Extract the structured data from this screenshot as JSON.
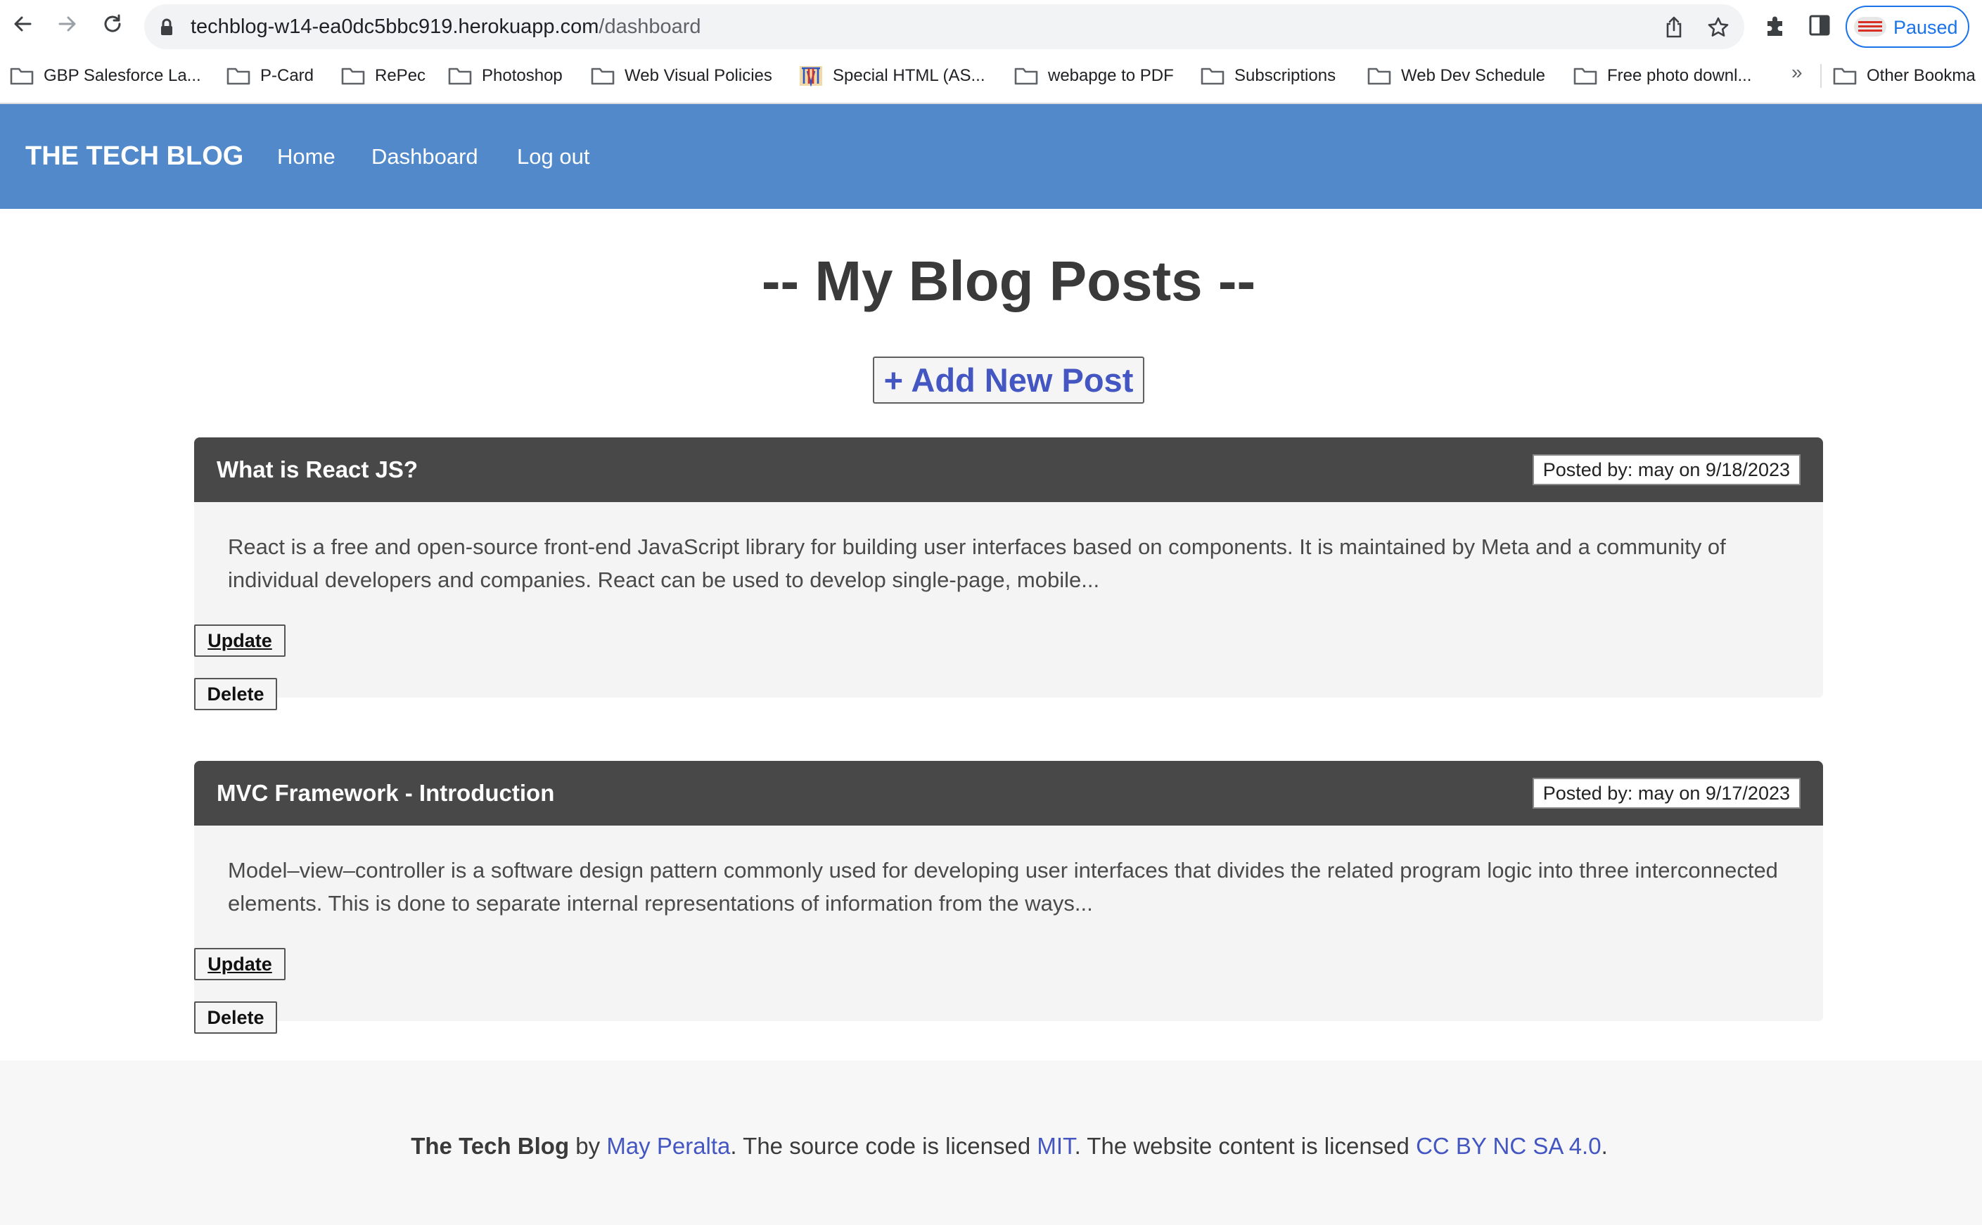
{
  "browser": {
    "url_host": "techblog-w14-ea0dc5bbc919.herokuapp.com",
    "url_path": "/dashboard",
    "profile_status": "Paused",
    "icons": [
      "back-arrow-icon",
      "forward-arrow-icon",
      "reload-icon",
      "lock-icon",
      "share-icon",
      "star-icon",
      "extensions-puzzle-icon",
      "side-panel-icon"
    ],
    "bookmarks": [
      {
        "label": "GBP Salesforce La...",
        "icon": "folder-icon"
      },
      {
        "label": "P-Card",
        "icon": "folder-icon"
      },
      {
        "label": "RePec",
        "icon": "folder-icon"
      },
      {
        "label": "Photoshop",
        "icon": "folder-icon"
      },
      {
        "label": "Web Visual Policies",
        "icon": "folder-icon"
      },
      {
        "label": "Special HTML (AS...",
        "icon": "site-favicon-icon"
      },
      {
        "label": "webapge to PDF",
        "icon": "folder-icon"
      },
      {
        "label": "Subscriptions",
        "icon": "folder-icon"
      },
      {
        "label": "Web Dev Schedule",
        "icon": "folder-icon"
      },
      {
        "label": "Free photo downl...",
        "icon": "folder-icon"
      }
    ],
    "bookmarks_more": "»",
    "other_bookmarks": "Other Bookma"
  },
  "site": {
    "brand": "THE TECH BLOG",
    "nav": {
      "home": "Home",
      "dashboard": "Dashboard",
      "logout": "Log out"
    },
    "header_color": "#5189cb"
  },
  "main": {
    "title": "-- My Blog Posts --",
    "add_button": "+ Add New Post",
    "posts": [
      {
        "title": "What is React JS?",
        "meta": "Posted by: may on 9/18/2023",
        "body": "React is a free and open-source front-end JavaScript library for building user interfaces based on components. It is maintained by Meta and a community of individual developers and companies. React can be used to develop single-page, mobile...",
        "update_label": "Update",
        "delete_label": "Delete"
      },
      {
        "title": "MVC Framework - Introduction",
        "meta": "Posted by: may on 9/17/2023",
        "body": "Model–view–controller is a software design pattern commonly used for developing user interfaces that divides the related program logic into three interconnected elements. This is done to separate internal representations of information from the ways...",
        "update_label": "Update",
        "delete_label": "Delete"
      }
    ]
  },
  "footer": {
    "site_name": "The Tech Blog",
    "by": " by ",
    "author": "May Peralta",
    "text1": ". The source code is licensed ",
    "license_code": "MIT",
    "text2": ". The website content is licensed ",
    "license_content": "CC BY NC SA 4.0",
    "text3": "."
  },
  "colors": {
    "accent_link": "#4456c1",
    "post_header": "#484848",
    "chrome_blue": "#1a73e8"
  }
}
